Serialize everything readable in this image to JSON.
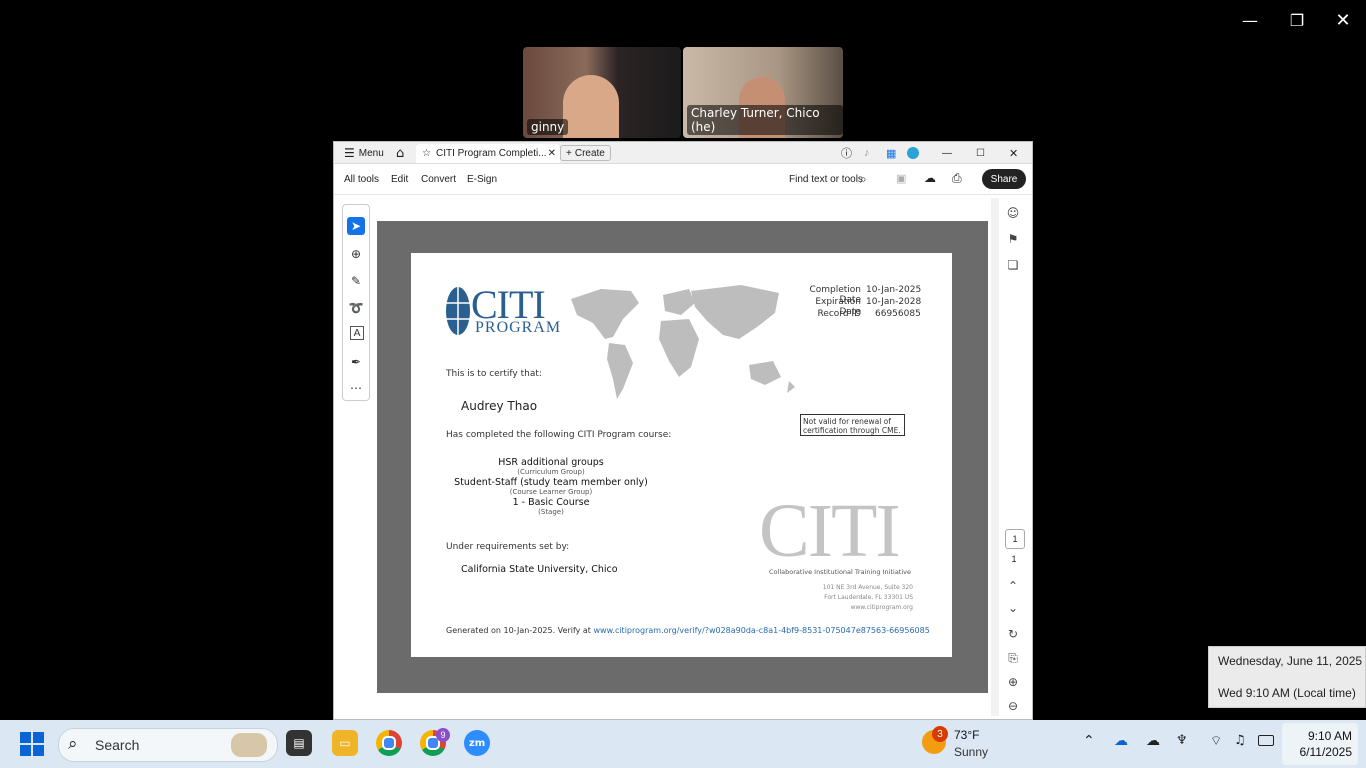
{
  "zoom_meeting": {
    "participants": [
      {
        "name": "ginny"
      },
      {
        "name": "Charley Turner, Chico (he)"
      }
    ]
  },
  "acrobat": {
    "menu_label": "Menu",
    "tab_title": "CITI Program Completi...",
    "create_label": "Create",
    "tools": {
      "all_tools": "All tools",
      "edit": "Edit",
      "convert": "Convert",
      "esign": "E-Sign",
      "find": "Find text or tools",
      "share": "Share"
    },
    "page_nav": {
      "current": "1",
      "total": "1"
    }
  },
  "certificate": {
    "logo_main": "CITI",
    "logo_sub": "PROGRAM",
    "completion_label": "Completion Date",
    "completion_value": "10-Jan-2025",
    "expiration_label": "Expiration Date",
    "expiration_value": "10-Jan-2028",
    "record_label": "Record ID",
    "record_value": "66956085",
    "certify_text": "This is to certify that:",
    "recipient": "Audrey Thao",
    "completed_text": "Has completed the following CITI Program course:",
    "notice": "Not valid for renewal of certification through CME.",
    "course_lines": [
      {
        "main": "HSR additional groups",
        "sub": "(Curriculum Group)"
      },
      {
        "main": "Student-Staff (study team member only)",
        "sub": "(Course Learner Group)"
      },
      {
        "main": "1 - Basic Course",
        "sub": "(Stage)"
      }
    ],
    "requirements_text": "Under requirements set by:",
    "institution": "California State University, Chico",
    "big_logo": "CITI",
    "initiative": "Collaborative Institutional Training Initiative",
    "address1": "101 NE 3rd Avenue, Suite 320",
    "address2": "Fort Lauderdale, FL 33301 US",
    "website": "www.citiprogram.org",
    "generated_prefix": "Generated on 10-Jan-2025. Verify at ",
    "verify_link": "www.citiprogram.org/verify/?w028a90da-c8a1-4bf9-8531-075047e87563-66956085"
  },
  "tooltip": {
    "date": "Wednesday, June 11, 2025",
    "time": "Wed 9:10 AM (Local time)"
  },
  "taskbar": {
    "search_placeholder": "Search",
    "chrome_badge": "9",
    "weather_badge": "3",
    "weather_temp": "73°F",
    "weather_desc": "Sunny",
    "clock_time": "9:10 AM",
    "clock_date": "6/11/2025"
  },
  "colors": {
    "accent": "#1473e6",
    "citi_blue": "#2a5f8f",
    "taskbar": "#dbe8f4",
    "viewer_bg": "#6b6b6b"
  }
}
